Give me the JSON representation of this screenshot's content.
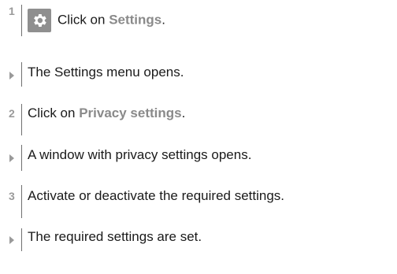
{
  "steps": [
    {
      "marker": "1",
      "prefix": "Click on ",
      "highlight": "Settings",
      "suffix": ".",
      "icon": "gear-icon"
    },
    {
      "marker": "arrow",
      "text": "The Settings menu opens."
    },
    {
      "marker": "2",
      "prefix": "Click on ",
      "highlight": "Privacy settings",
      "suffix": "."
    },
    {
      "marker": "arrow",
      "text": "A window with privacy settings opens."
    },
    {
      "marker": "3",
      "text": "Activate or deactivate the required settings."
    },
    {
      "marker": "arrow",
      "text": "The required settings are set."
    }
  ],
  "colors": {
    "highlight": "#8a8a8a",
    "icon_background": "#8f8f8f",
    "marker": "#9a9a9a"
  }
}
